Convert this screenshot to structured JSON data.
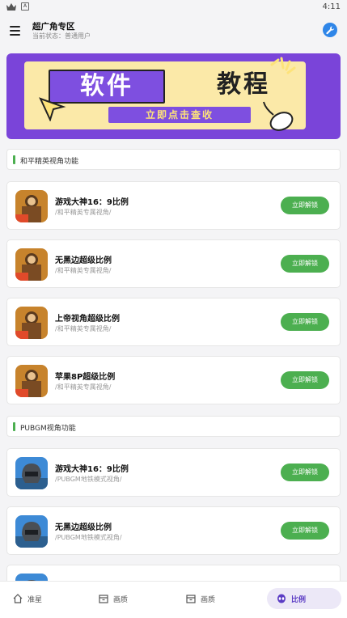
{
  "status_bar": {
    "time": "4:11",
    "icons": [
      "crown-icon",
      "a-badge-icon"
    ]
  },
  "app_bar": {
    "title": "超广角专区",
    "subtitle": "当前状态：普通用户",
    "menu_icon": "menu-icon",
    "action_icon": "wrench-icon",
    "accent": "#2f86e8"
  },
  "banner": {
    "word1": "软件",
    "word2": "教程",
    "button": "立即点击查收",
    "bg": "#7a44d9",
    "panel": "#fbe9a8"
  },
  "sections": [
    {
      "title": "和平精英视角功能",
      "items": [
        {
          "title": "游戏大神16：9比例",
          "sub": "/和平精英专属视角/",
          "button": "立即解锁"
        },
        {
          "title": "无黑边超级比例",
          "sub": "/和平精英专属视角/",
          "button": "立即解锁"
        },
        {
          "title": "上帝视角超级比例",
          "sub": "/和平精英专属视角/",
          "button": "立即解锁"
        },
        {
          "title": "苹果8P超级比例",
          "sub": "/和平精英专属视角/",
          "button": "立即解锁"
        }
      ]
    },
    {
      "title": "PUBGM视角功能",
      "items": [
        {
          "title": "游戏大神16：9比例",
          "sub": "/PUBGM地铁模式视角/",
          "button": "立即解锁"
        },
        {
          "title": "无黑边超级比例",
          "sub": "/PUBGM地铁模式视角/",
          "button": "立即解锁"
        }
      ]
    }
  ],
  "bottom_nav": [
    {
      "label": "准星",
      "icon": "home-icon",
      "active": false
    },
    {
      "label": "画质",
      "icon": "box-icon",
      "active": false
    },
    {
      "label": "画质",
      "icon": "box-icon",
      "active": false
    },
    {
      "label": "比例",
      "icon": "alien-icon",
      "active": true
    }
  ],
  "colors": {
    "green": "#4caf50",
    "purple": "#7e4fe0",
    "active_nav": "#5b3cc4"
  }
}
